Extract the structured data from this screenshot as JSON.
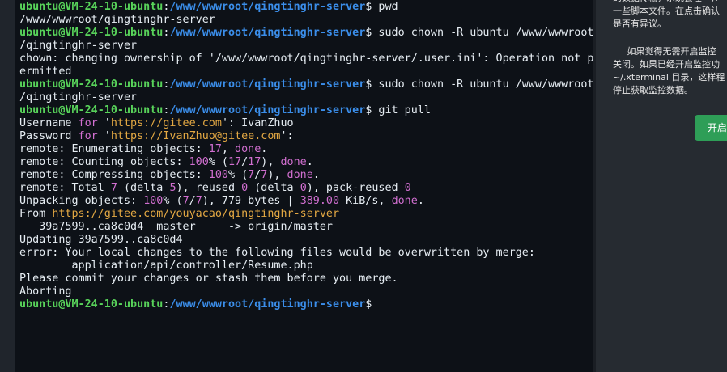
{
  "prompt": {
    "user": "ubuntu@VM-24-10-ubuntu",
    "sep": ":",
    "path": "/www/wwwroot/qingtinghr-server",
    "suffix": "$ "
  },
  "terminal": {
    "lines": [
      {
        "kind": "prompt",
        "cmd": "pwd"
      },
      {
        "kind": "plain",
        "text": "/www/wwwroot/qingtinghr-server"
      },
      {
        "kind": "prompt",
        "cmd": "sudo chown -R ubuntu /www/wwwroot"
      },
      {
        "kind": "plain",
        "text": "/qingtinghr-server"
      },
      {
        "kind": "plain",
        "text": "chown: changing ownership of '/www/wwwroot/qingtinghr-server/.user.ini': Operation not p"
      },
      {
        "kind": "plain",
        "text": "ermitted"
      },
      {
        "kind": "prompt",
        "cmd": "sudo chown -R ubuntu /www/wwwroot"
      },
      {
        "kind": "plain",
        "text": "/qingtinghr-server"
      },
      {
        "kind": "prompt",
        "cmd": "git pull"
      },
      {
        "kind": "rich",
        "segments": [
          {
            "t": "Username "
          },
          {
            "t": "for",
            "c": "kw"
          },
          {
            "t": " '"
          },
          {
            "t": "https://gitee.com",
            "c": "str"
          },
          {
            "t": "': IvanZhuo"
          }
        ]
      },
      {
        "kind": "rich",
        "segments": [
          {
            "t": "Password "
          },
          {
            "t": "for",
            "c": "kw"
          },
          {
            "t": " '"
          },
          {
            "t": "https://IvanZhuo@gitee.com",
            "c": "str"
          },
          {
            "t": "':"
          }
        ]
      },
      {
        "kind": "rich",
        "segments": [
          {
            "t": "remote: Enumerating objects: "
          },
          {
            "t": "17",
            "c": "num"
          },
          {
            "t": ", "
          },
          {
            "t": "done",
            "c": "done"
          },
          {
            "t": "."
          }
        ]
      },
      {
        "kind": "rich",
        "segments": [
          {
            "t": "remote: Counting objects: "
          },
          {
            "t": "100",
            "c": "num"
          },
          {
            "t": "% ("
          },
          {
            "t": "17",
            "c": "num"
          },
          {
            "t": "/"
          },
          {
            "t": "17",
            "c": "num"
          },
          {
            "t": "), "
          },
          {
            "t": "done",
            "c": "done"
          },
          {
            "t": "."
          }
        ]
      },
      {
        "kind": "rich",
        "segments": [
          {
            "t": "remote: Compressing objects: "
          },
          {
            "t": "100",
            "c": "num"
          },
          {
            "t": "% ("
          },
          {
            "t": "7",
            "c": "num"
          },
          {
            "t": "/"
          },
          {
            "t": "7",
            "c": "num"
          },
          {
            "t": "), "
          },
          {
            "t": "done",
            "c": "done"
          },
          {
            "t": "."
          }
        ]
      },
      {
        "kind": "rich",
        "segments": [
          {
            "t": "remote: Total "
          },
          {
            "t": "7",
            "c": "num"
          },
          {
            "t": " (delta "
          },
          {
            "t": "5",
            "c": "num"
          },
          {
            "t": "), reused "
          },
          {
            "t": "0",
            "c": "num"
          },
          {
            "t": " (delta "
          },
          {
            "t": "0",
            "c": "num"
          },
          {
            "t": "), pack-reused "
          },
          {
            "t": "0",
            "c": "num"
          }
        ]
      },
      {
        "kind": "rich",
        "segments": [
          {
            "t": "Unpacking objects: "
          },
          {
            "t": "100",
            "c": "num"
          },
          {
            "t": "% ("
          },
          {
            "t": "7",
            "c": "num"
          },
          {
            "t": "/"
          },
          {
            "t": "7",
            "c": "num"
          },
          {
            "t": "), 779 bytes | "
          },
          {
            "t": "389.00",
            "c": "num"
          },
          {
            "t": " KiB/s, "
          },
          {
            "t": "done",
            "c": "done"
          },
          {
            "t": "."
          }
        ]
      },
      {
        "kind": "rich",
        "segments": [
          {
            "t": "From "
          },
          {
            "t": "https://gitee.com/youyacao/qingtinghr-server",
            "c": "url"
          }
        ]
      },
      {
        "kind": "plain",
        "text": "   39a7599..ca8c0d4  master     -> origin/master"
      },
      {
        "kind": "plain",
        "text": "Updating 39a7599..ca8c0d4"
      },
      {
        "kind": "plain",
        "text": "error: Your local changes to the following files would be overwritten by merge:"
      },
      {
        "kind": "plain",
        "text": "        application/api/controller/Resume.php"
      },
      {
        "kind": "plain",
        "text": "Please commit your changes or stash them before you merge."
      },
      {
        "kind": "plain",
        "text": "Aborting"
      },
      {
        "kind": "prompt",
        "cmd": ""
      }
    ]
  },
  "side_panel": {
    "para1": "的数据传输，系统会在 ~/.\n一些脚本文件。在点击确认\n是否有异议。",
    "para2": "     如果觉得无需开启监控\n关闭。如果已经开启监控功\n~/.xterminal 目录，这样程\n停止获取监控数据。",
    "open_button_label": "开启",
    "open_button_color": "#2e9e57"
  }
}
